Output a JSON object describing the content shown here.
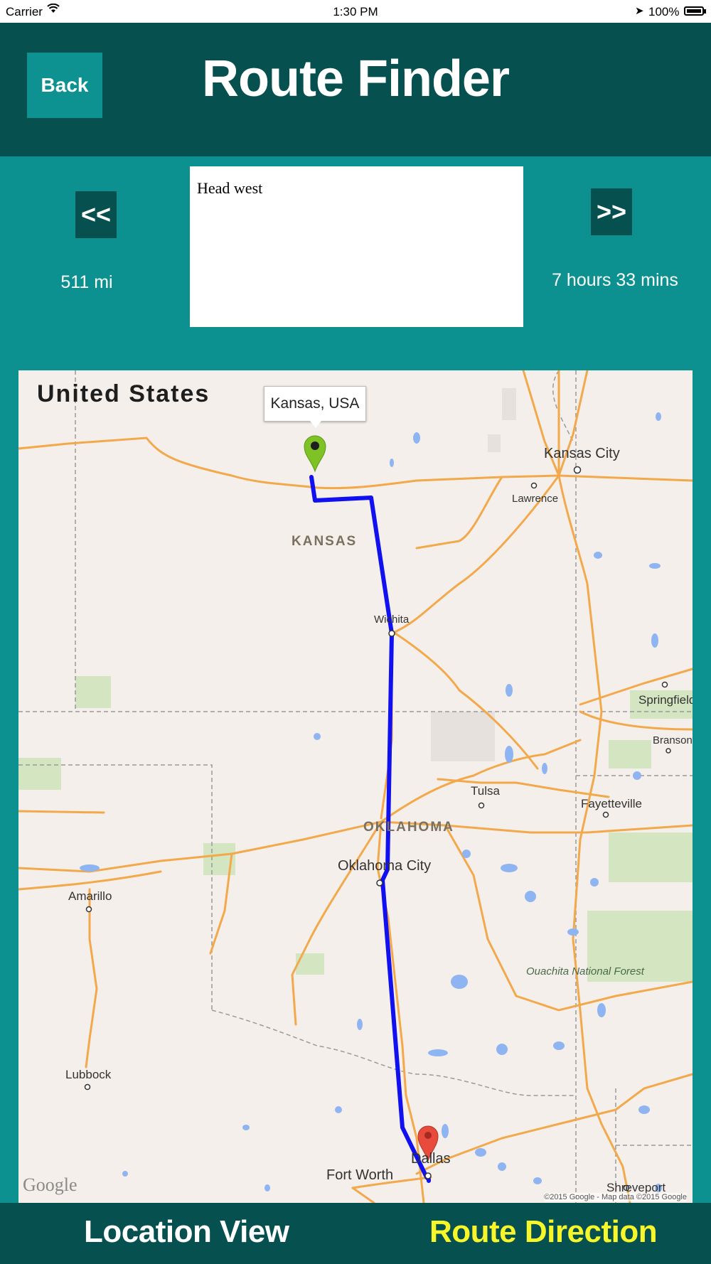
{
  "status_bar": {
    "carrier": "Carrier",
    "time": "1:30 PM",
    "battery": "100%"
  },
  "header": {
    "back_label": "Back",
    "title": "Route Finder"
  },
  "navigation": {
    "prev_label": "<<",
    "next_label": ">>",
    "distance": "511 mi",
    "duration": "7 hours 33 mins",
    "direction_text": "Head west"
  },
  "map": {
    "country_label": "United States",
    "callout": "Kansas, USA",
    "states": [
      "KANSAS",
      "OKLAHOMA"
    ],
    "cities": [
      "Kansas City",
      "Lawrence",
      "Wichita",
      "Springfield",
      "Branson",
      "Tulsa",
      "Fayetteville",
      "Oklahoma City",
      "Amarillo",
      "Lubbock",
      "Dallas",
      "Fort Worth",
      "Shreveport"
    ],
    "forest_label": "Ouachita National Forest",
    "logo": "Google",
    "copyright": "©2015 Google - Map data ©2015 Google",
    "route_color": "#1010f0",
    "start_marker_color": "#7ec225",
    "end_marker_color": "#e84b3c"
  },
  "tabs": {
    "location_view": "Location View",
    "route_direction": "Route Direction"
  }
}
